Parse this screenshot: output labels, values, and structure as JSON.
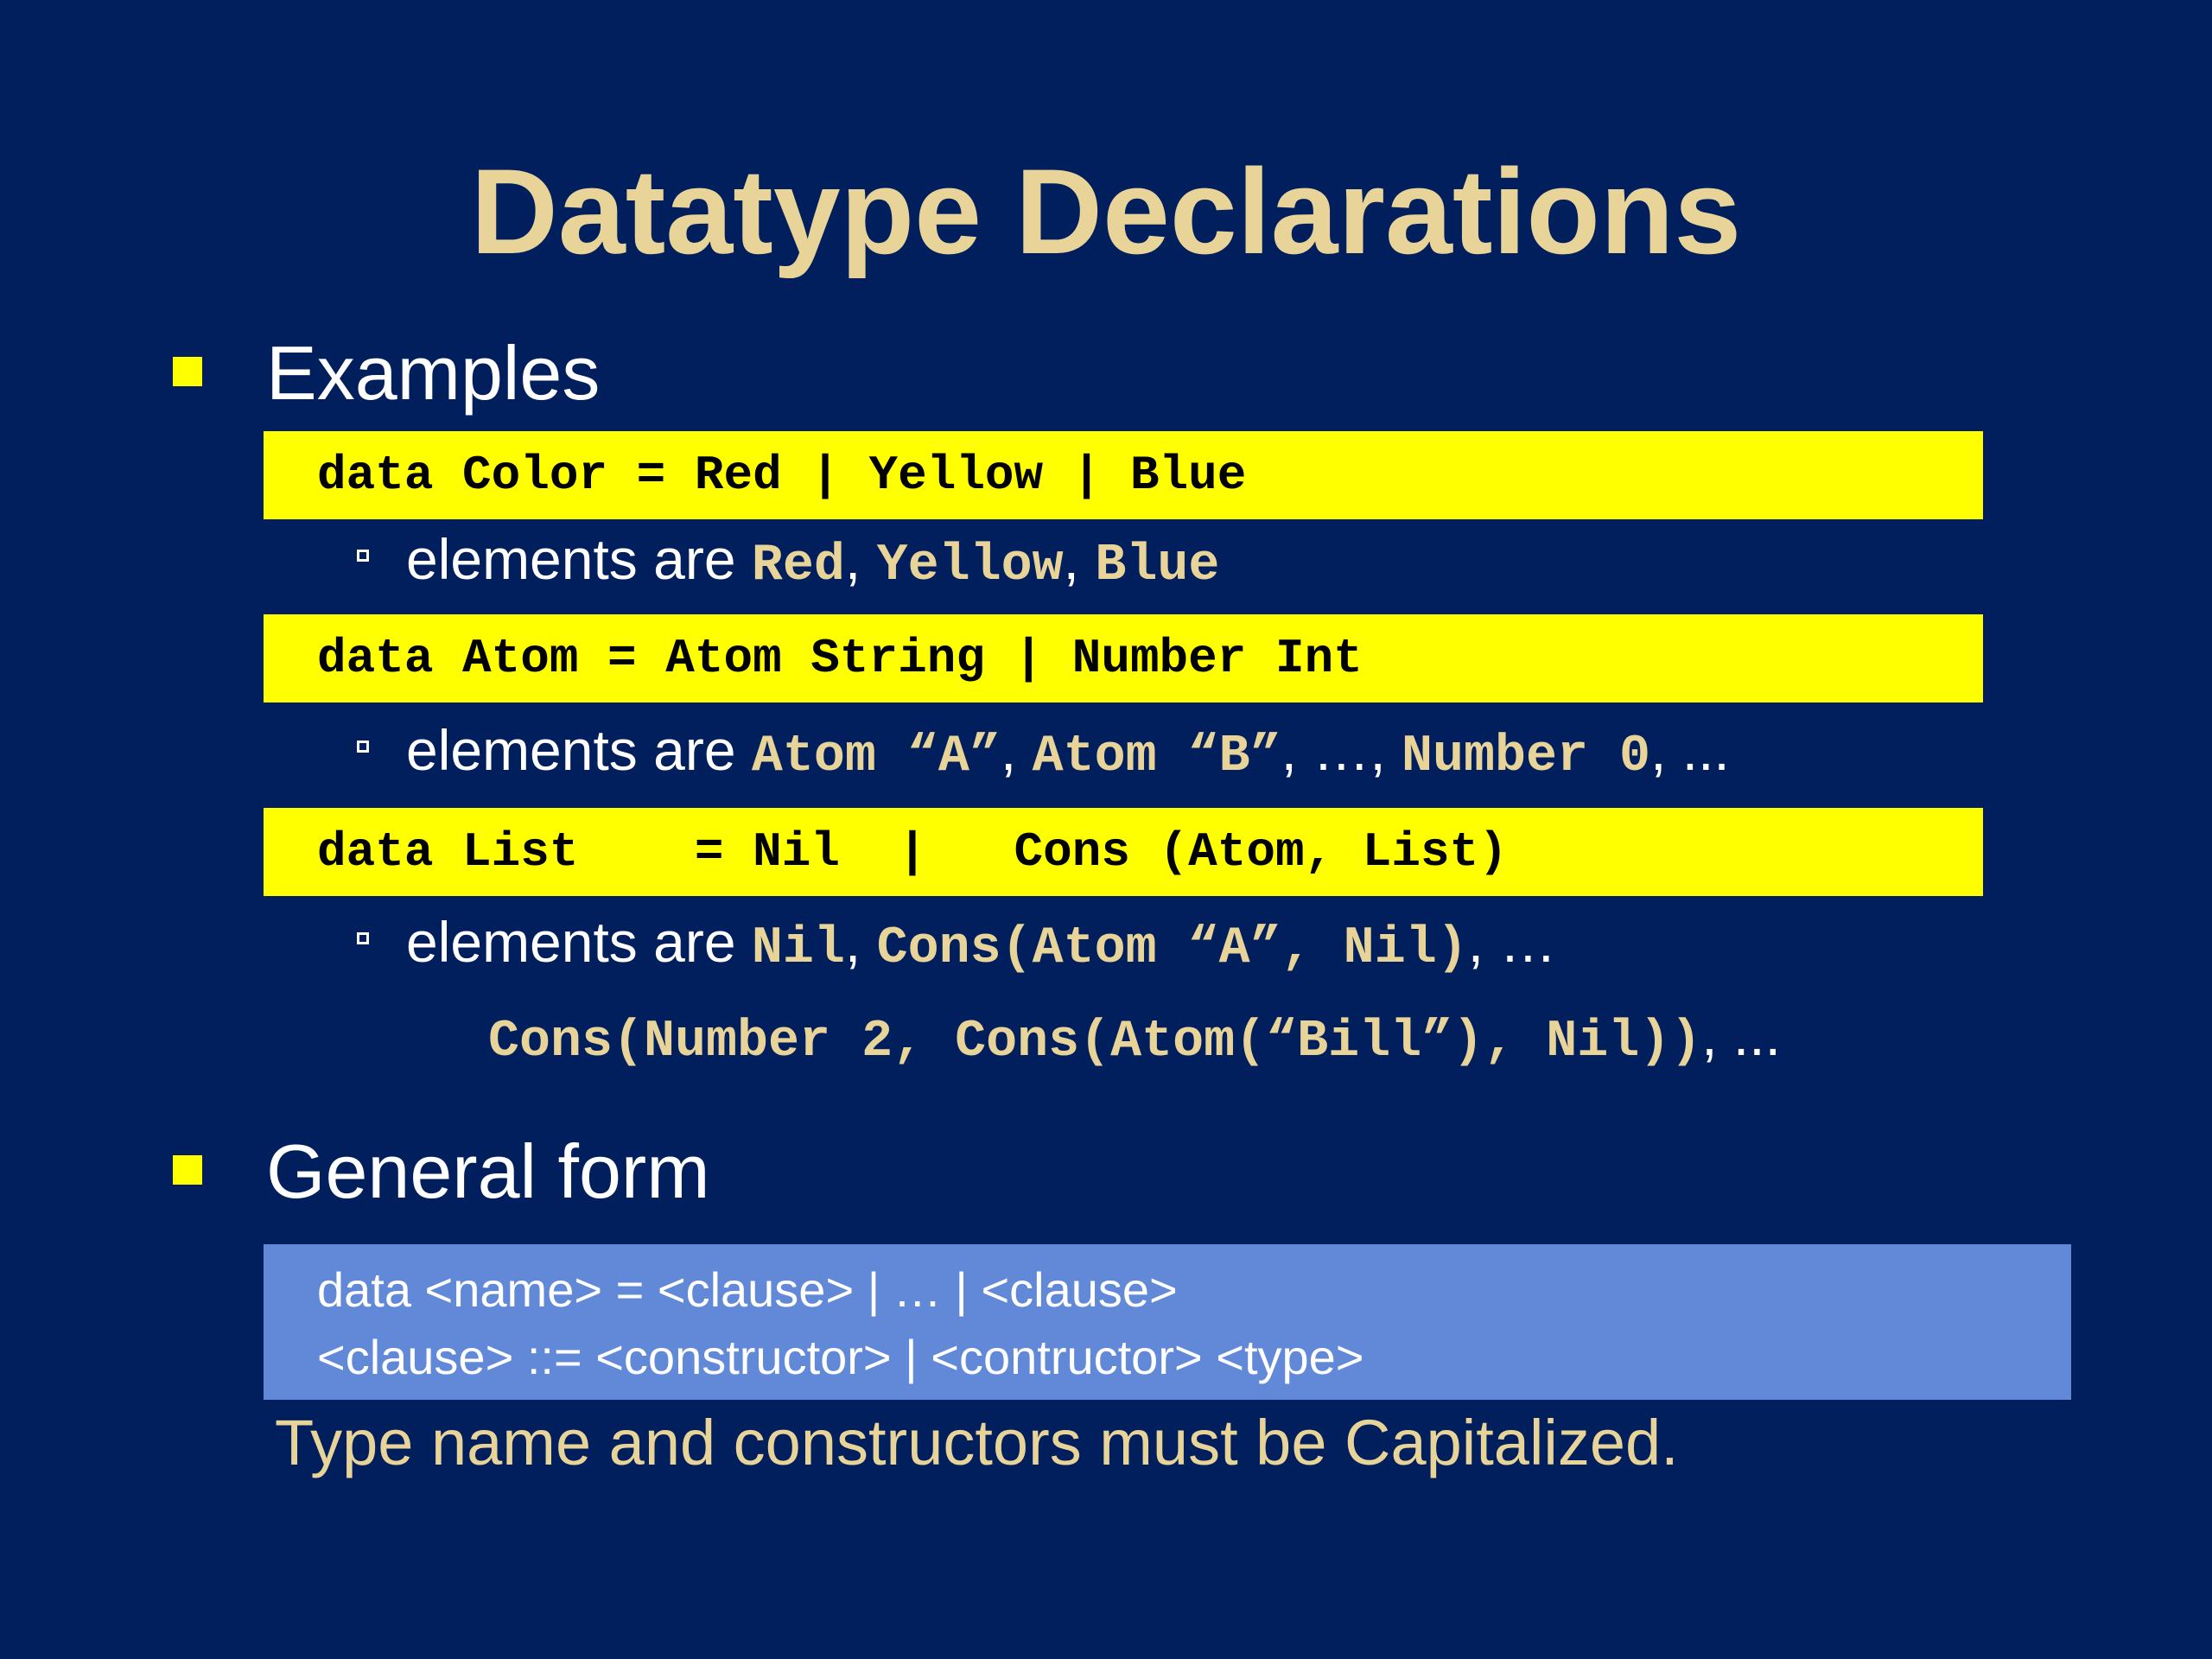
{
  "title": "Datatype Declarations",
  "colors": {
    "background": "#001f5c",
    "title": "#e8d398",
    "bullet": "#ffff00",
    "code_band": "#ffff00",
    "form_box": "#6289d8"
  },
  "bullets": [
    {
      "label": "Examples"
    },
    {
      "label": "General form"
    }
  ],
  "examples": [
    {
      "code": "data Color = Red | Yellow | Blue",
      "elements": {
        "prefix": "elements are ",
        "parts": [
          {
            "text": "Red",
            "code": true
          },
          {
            "text": ", ",
            "code": false
          },
          {
            "text": "Yellow",
            "code": true
          },
          {
            "text": ", ",
            "code": false
          },
          {
            "text": "Blue",
            "code": true
          }
        ]
      }
    },
    {
      "code": "data Atom = Atom String | Number Int",
      "elements": {
        "prefix": "elements are ",
        "parts": [
          {
            "text": "Atom “A”",
            "code": true
          },
          {
            "text": ", ",
            "code": false
          },
          {
            "text": "Atom “B”",
            "code": true
          },
          {
            "text": ", …, ",
            "code": false
          },
          {
            "text": "Number 0",
            "code": true
          },
          {
            "text": ", ...",
            "code": false
          }
        ]
      }
    },
    {
      "code": "data List    = Nil  |   Cons (Atom, List)",
      "elements": {
        "prefix": "elements are ",
        "parts": [
          {
            "text": "Nil",
            "code": true
          },
          {
            "text": ", ",
            "code": false
          },
          {
            "text": "Cons(Atom “A”, Nil)",
            "code": true
          },
          {
            "text": ", …",
            "code": false
          }
        ],
        "continuation": [
          {
            "text": "Cons(Number 2, Cons(Atom(“Bill”), Nil))",
            "code": true
          },
          {
            "text": ", ...",
            "code": false
          }
        ]
      }
    }
  ],
  "general_form": {
    "lines": [
      "data <name> = <clause> | … | <clause>",
      "<clause> ::= <constructor> | <contructor> <type>"
    ]
  },
  "note": "Type name and constructors must be Capitalized."
}
